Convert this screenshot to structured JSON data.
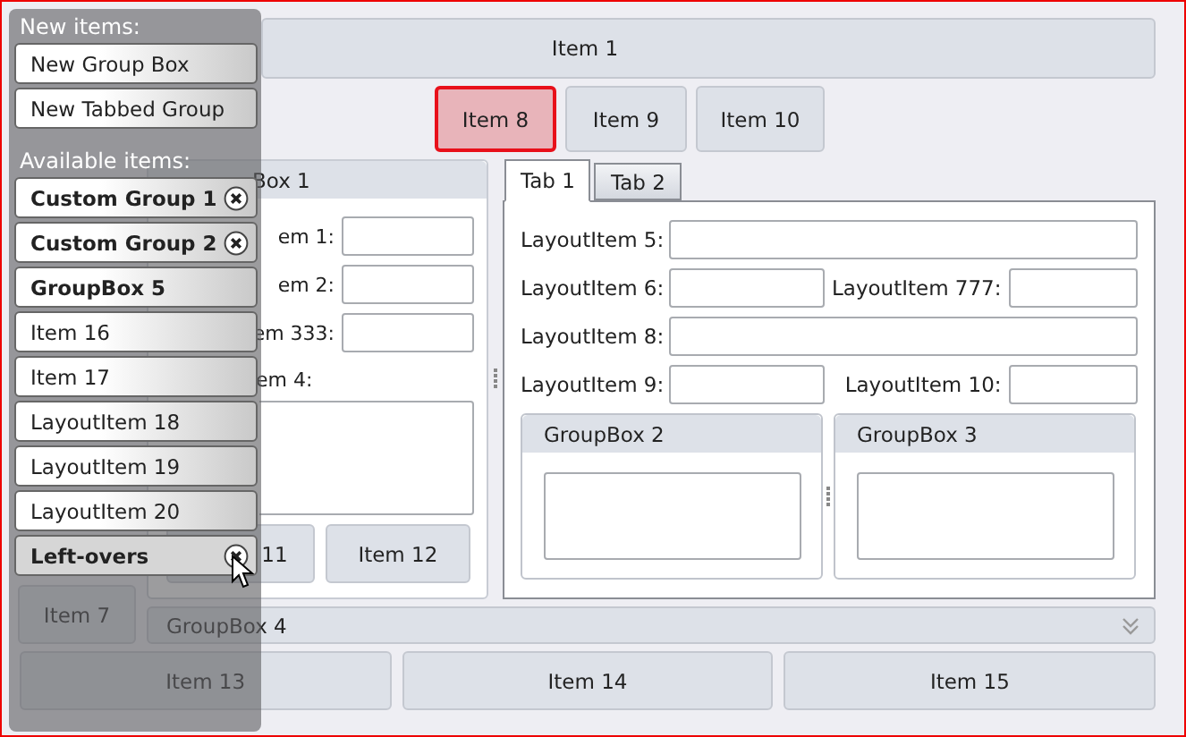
{
  "main": {
    "top_button": "Item 1",
    "buttons": [
      {
        "label": "Item 8",
        "selected": true
      },
      {
        "label": "Item 9",
        "selected": false
      },
      {
        "label": "Item 10",
        "selected": false
      }
    ],
    "group_box_1": {
      "title": "Box 1",
      "fields": [
        {
          "label": "em 1:",
          "kind": "input"
        },
        {
          "label": "em 2:",
          "kind": "input"
        },
        {
          "label": "em 333:",
          "kind": "input"
        },
        {
          "label": "em 4:",
          "kind": "textarea"
        }
      ],
      "buttons": [
        "11",
        "Item 12"
      ]
    },
    "tabs": [
      {
        "label": "Tab 1",
        "selected": true
      },
      {
        "label": "Tab 2",
        "selected": false
      }
    ],
    "tab_rows": [
      [
        {
          "label": "LayoutItem 5:",
          "kind": "wide"
        }
      ],
      [
        {
          "label": "LayoutItem 6:",
          "kind": "narrow"
        },
        {
          "label": "LayoutItem 777:",
          "kind": "narrow"
        }
      ],
      [
        {
          "label": "LayoutItem 8:",
          "kind": "wide"
        }
      ],
      [
        {
          "label": "LayoutItem 9:",
          "kind": "narrow"
        },
        {
          "label": "LayoutItem 10:",
          "kind": "narrow"
        }
      ]
    ],
    "group_boxes": [
      {
        "title": "GroupBox 2"
      },
      {
        "title": "GroupBox 3"
      }
    ],
    "side_button": "Item 7",
    "group_box_4": {
      "title": "GroupBox 4",
      "expanded": false
    },
    "bottom_buttons": [
      "Item 13",
      "Item 14",
      "Item 15"
    ]
  },
  "customization_panel": {
    "sections": [
      {
        "title": "New items:",
        "items": [
          {
            "label": "New Group Box",
            "kind": "item",
            "removable": false,
            "hovered": false
          },
          {
            "label": "New Tabbed Group",
            "kind": "item",
            "removable": false,
            "hovered": false
          }
        ]
      },
      {
        "title": "Available items:",
        "items": [
          {
            "label": "Custom Group 1",
            "kind": "group",
            "removable": true,
            "hovered": false
          },
          {
            "label": "Custom Group 2",
            "kind": "group",
            "removable": true,
            "hovered": false
          },
          {
            "label": "GroupBox 5",
            "kind": "group",
            "removable": false,
            "hovered": false
          },
          {
            "label": "Item 16",
            "kind": "item",
            "removable": false,
            "hovered": false
          },
          {
            "label": "Item 17",
            "kind": "item",
            "removable": false,
            "hovered": false
          },
          {
            "label": "LayoutItem 18",
            "kind": "item",
            "removable": false,
            "hovered": false
          },
          {
            "label": "LayoutItem 19",
            "kind": "item",
            "removable": false,
            "hovered": false
          },
          {
            "label": "LayoutItem 20",
            "kind": "item",
            "removable": false,
            "hovered": false
          },
          {
            "label": "Left-overs",
            "kind": "group",
            "removable": true,
            "hovered": true
          }
        ]
      }
    ]
  }
}
